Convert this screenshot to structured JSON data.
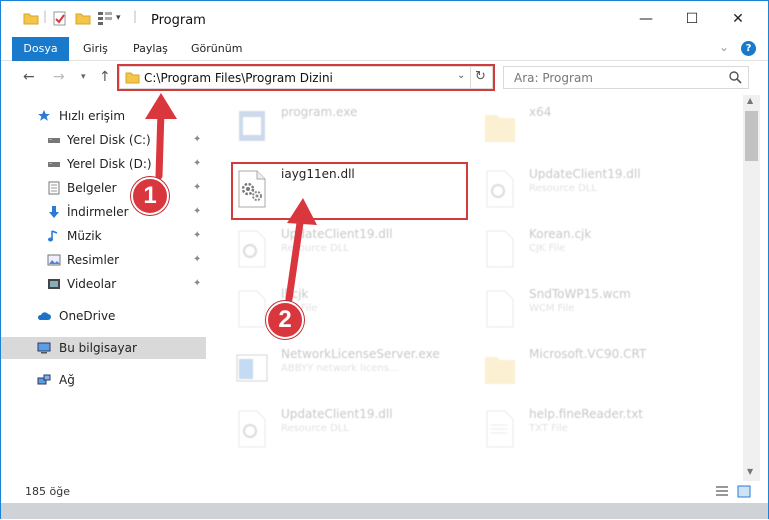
{
  "window": {
    "title": "Program",
    "minimize_glyph": "—",
    "maximize_glyph": "☐",
    "close_glyph": "✕"
  },
  "ribbon": {
    "tabs": [
      "Dosya",
      "Giriş",
      "Paylaş",
      "Görünüm"
    ],
    "help_glyph": "?",
    "collapse_glyph": "⌄"
  },
  "address": {
    "path": "C:\\Program Files\\Program Dizini",
    "search_placeholder": "Ara: Program"
  },
  "sidebar": {
    "items": [
      {
        "label": "Hızlı erişim",
        "icon": "star-icon",
        "pinned": false
      },
      {
        "label": "Yerel Disk (C:)",
        "icon": "drive-icon",
        "pinned": true
      },
      {
        "label": "Yerel Disk (D:)",
        "icon": "drive-icon",
        "pinned": true
      },
      {
        "label": "Belgeler",
        "icon": "documents-icon",
        "pinned": true
      },
      {
        "label": "İndirmeler",
        "icon": "download-icon",
        "pinned": true
      },
      {
        "label": "Müzik",
        "icon": "music-icon",
        "pinned": true
      },
      {
        "label": "Resimler",
        "icon": "pictures-icon",
        "pinned": true
      },
      {
        "label": "Videolar",
        "icon": "videos-icon",
        "pinned": true
      },
      {
        "label": "OneDrive",
        "icon": "cloud-icon",
        "pinned": false
      },
      {
        "label": "Bu bilgisayar",
        "icon": "computer-icon",
        "pinned": false,
        "selected": true
      },
      {
        "label": "Ağ",
        "icon": "network-icon",
        "pinned": false
      }
    ],
    "pin_glyph": "📌"
  },
  "files": [
    {
      "name": "program.exe",
      "type": "",
      "icon": "exe-icon",
      "faded": true
    },
    {
      "name": "x64",
      "type": "",
      "icon": "folder-icon",
      "faded": true
    },
    {
      "name": "iayg11en.dll",
      "type": "",
      "icon": "dll-gear-icon",
      "faded": false
    },
    {
      "name": "UpdateClient19.dll",
      "type": "Resource DLL",
      "icon": "dll-gear-icon",
      "faded": true
    },
    {
      "name": "UpdateClient19.dll",
      "type": "Resource DLL",
      "icon": "dll-gear-icon",
      "faded": true
    },
    {
      "name": "Korean.cjk",
      "type": "CJK File",
      "icon": "file-icon",
      "faded": true
    },
    {
      "name": "ll.cjk",
      "type": "CJK File",
      "icon": "file-icon",
      "faded": true
    },
    {
      "name": "SndToWP15.wcm",
      "type": "WCM File",
      "icon": "file-icon",
      "faded": true
    },
    {
      "name": "NetworkLicenseServer.exe",
      "type": "ABBYY network licens...",
      "icon": "exe-window-icon",
      "faded": true
    },
    {
      "name": "Microsoft.VC90.CRT",
      "type": "",
      "icon": "folder-icon",
      "faded": true
    },
    {
      "name": "UpdateClient19.dll",
      "type": "Resource DLL",
      "icon": "dll-gear-icon",
      "faded": true
    },
    {
      "name": "help.fineReader.txt",
      "type": "TXT File",
      "icon": "text-file-icon",
      "faded": true
    }
  ],
  "status": {
    "item_count": "185 öğe"
  },
  "callouts": [
    "1",
    "2"
  ],
  "colors": {
    "accent": "#1979ca",
    "highlight": "#d23b3b",
    "callout": "#d9363e"
  }
}
